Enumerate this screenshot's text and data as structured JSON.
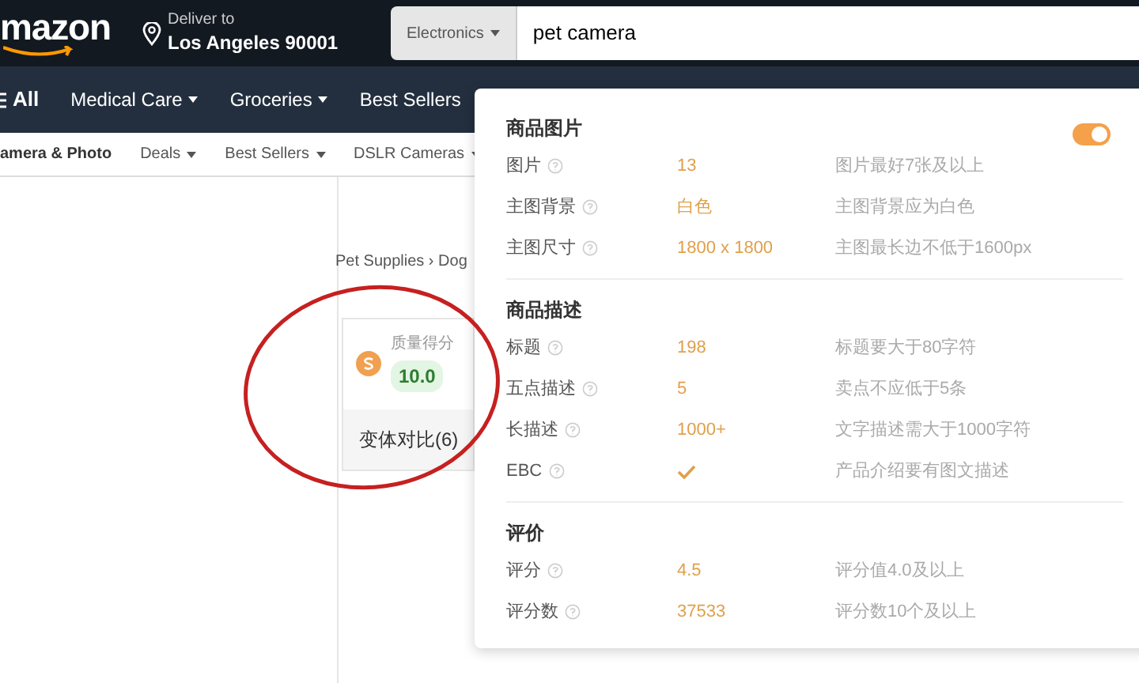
{
  "header": {
    "logo": "mazon",
    "deliver_label": "Deliver to",
    "deliver_location": "Los Angeles 90001",
    "search_category": "Electronics",
    "search_value": "pet camera"
  },
  "nav": {
    "all": "All",
    "items": [
      {
        "label": "Medical Care",
        "dropdown": true
      },
      {
        "label": "Groceries",
        "dropdown": true
      },
      {
        "label": "Best Sellers",
        "dropdown": false
      }
    ]
  },
  "subnav": {
    "items": [
      {
        "label": "amera & Photo",
        "bold": true,
        "dropdown": false
      },
      {
        "label": "Deals",
        "bold": false,
        "dropdown": true
      },
      {
        "label": "Best Sellers",
        "bold": false,
        "dropdown": true
      },
      {
        "label": "DSLR Cameras",
        "bold": false,
        "dropdown": true
      }
    ]
  },
  "breadcrumb": "Pet Supplies › Dog",
  "score_card": {
    "label": "质量得分",
    "score": "10.0",
    "variants": "变体对比(6)"
  },
  "panel": {
    "toggle": {
      "on": true
    },
    "sections": [
      {
        "title": "商品图片",
        "rows": [
          {
            "label": "图片",
            "kind": "text",
            "value": "13",
            "hint": "图片最好7张及以上"
          },
          {
            "label": "主图背景",
            "kind": "text",
            "value": "白色",
            "hint": "主图背景应为白色"
          },
          {
            "label": "主图尺寸",
            "kind": "text",
            "value": "1800 x 1800",
            "hint": "主图最长边不低于1600px"
          }
        ]
      },
      {
        "title": "商品描述",
        "rows": [
          {
            "label": "标题",
            "kind": "text",
            "value": "198",
            "hint": "标题要大于80字符"
          },
          {
            "label": "五点描述",
            "kind": "text",
            "value": "5",
            "hint": "卖点不应低于5条"
          },
          {
            "label": "长描述",
            "kind": "text",
            "value": "1000+",
            "hint": "文字描述需大于1000字符"
          },
          {
            "label": "EBC",
            "kind": "check",
            "checked": true,
            "hint": "产品介绍要有图文描述"
          }
        ]
      },
      {
        "title": "评价",
        "rows": [
          {
            "label": "评分",
            "kind": "text",
            "value": "4.5",
            "hint": "评分值4.0及以上"
          },
          {
            "label": "评分数",
            "kind": "text",
            "value": "37533",
            "hint": "评分数10个及以上"
          }
        ]
      }
    ]
  }
}
